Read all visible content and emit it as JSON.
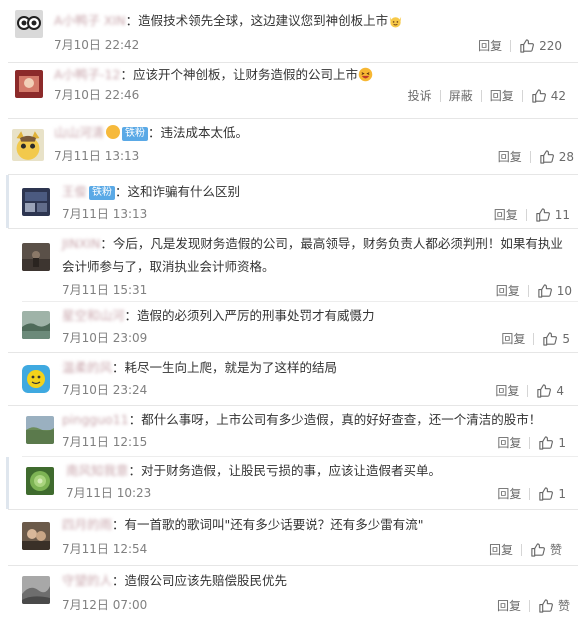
{
  "labels": {
    "reply": "回复",
    "report": "投诉",
    "block": "屏蔽",
    "fan_badge": "铁粉"
  },
  "comments": [
    {
      "user": "A小鸭子 XIN",
      "colon": "：",
      "text": "造假技术领先全球，这边建议您到神创板上市",
      "emoji": "cat-face-emoji",
      "time": "7月10日 22:42",
      "likes": "220"
    },
    {
      "user": "A小鸭子-12",
      "colon": "：",
      "text": "应该开个神创板，让财务造假的公司上市",
      "emoji": "laughing-face-emoji",
      "time": "7月10日 22:46",
      "likes": "42"
    },
    {
      "user": "山山河清",
      "colon": "：",
      "text": "违法成本太低。",
      "time": "7月11日 13:13",
      "likes": "28"
    },
    {
      "user": "王俊",
      "colon": "：",
      "text": "这和诈骗有什么区别",
      "time": "7月11日 13:13",
      "likes": "11"
    },
    {
      "user": "JINXIN",
      "colon": "：",
      "text": "今后，凡是发现财务造假的公司，最高领导，财务负责人都必须判刑！如果有执业会计师参与了，取消执业会计师资格。",
      "time": "7月11日 15:31",
      "likes": "10"
    },
    {
      "user": "星空和山河",
      "colon": "：",
      "text": "造假的必须列入严厉的刑事处罚才有威慑力",
      "time": "7月10日 23:09",
      "likes": "5"
    },
    {
      "user": "温柔的风",
      "colon": "：",
      "text": "耗尽一生向上爬，就是为了这样的结局",
      "time": "7月10日 23:24",
      "likes": "4"
    },
    {
      "user": "pingguo11",
      "colon": "：",
      "text": "都什么事呀，上市公司有多少造假，真的好好查查，还一个清洁的股市！",
      "time": "7月11日 12:15",
      "likes": "1"
    },
    {
      "user": "南风知我意",
      "colon": "：",
      "text": "对于财务造假，让股民亏损的事，应该让造假者买单。",
      "time": "7月11日 10:23",
      "likes": "1"
    },
    {
      "user": "四月的雨",
      "colon": "：",
      "text": "有一首歌的歌词叫\"还有多少话要说？还有多少雷有流\"",
      "time": "7月11日 12:54",
      "likes": "赞"
    },
    {
      "user": "守望的人",
      "colon": "：",
      "text": "造假公司应该先赔偿股民优先",
      "time": "7月12日 07:00",
      "likes": "赞"
    }
  ]
}
